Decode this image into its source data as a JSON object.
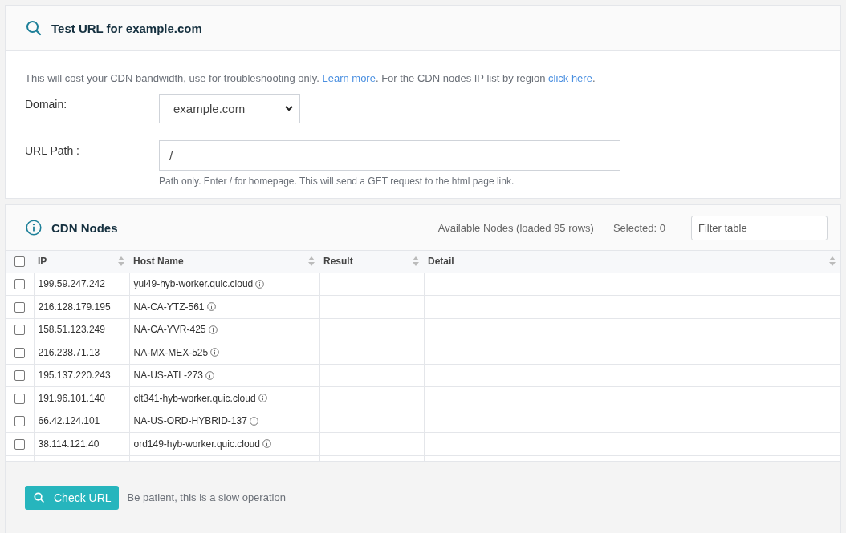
{
  "test_panel": {
    "title": "Test URL for example.com",
    "intro": [
      {
        "kind": "text",
        "text": "This will cost your CDN bandwidth, use for troubleshooting only. "
      },
      {
        "kind": "link",
        "text": "Learn more"
      },
      {
        "kind": "text",
        "text": ". For the CDN nodes IP list by region "
      },
      {
        "kind": "link",
        "text": "click here"
      },
      {
        "kind": "text",
        "text": "."
      }
    ],
    "domain": {
      "label": "Domain:",
      "value": "example.com"
    },
    "url_path": {
      "label": "URL Path :",
      "value": "/",
      "help": "Path only. Enter / for homepage. This will send a GET request to the html page link."
    }
  },
  "nodes_panel": {
    "title": "CDN Nodes",
    "available": "Available Nodes (loaded 95 rows)",
    "selected_count": "Selected: 0",
    "filter": {
      "placeholder": "Filter table"
    },
    "table": {
      "select_all": {
        "checked": false
      },
      "columns": [
        "IP",
        "Host Name",
        "Result",
        "Detail"
      ],
      "rows": [
        {
          "checked": false,
          "ip": "199.59.247.242",
          "host": "yul49-hyb-worker.quic.cloud"
        },
        {
          "checked": false,
          "ip": "216.128.179.195",
          "host": "NA-CA-YTZ-561"
        },
        {
          "checked": false,
          "ip": "158.51.123.249",
          "host": "NA-CA-YVR-425"
        },
        {
          "checked": false,
          "ip": "216.238.71.13",
          "host": "NA-MX-MEX-525"
        },
        {
          "checked": false,
          "ip": "195.137.220.243",
          "host": "NA-US-ATL-273"
        },
        {
          "checked": false,
          "ip": "191.96.101.140",
          "host": "clt341-hyb-worker.quic.cloud"
        },
        {
          "checked": false,
          "ip": "66.42.124.101",
          "host": "NA-US-ORD-HYBRID-137"
        },
        {
          "checked": false,
          "ip": "38.114.121.40",
          "host": "ord149-hyb-worker.quic.cloud"
        }
      ]
    }
  },
  "footer": {
    "button": "Check URL",
    "note": "Be patient, this is a slow operation"
  }
}
